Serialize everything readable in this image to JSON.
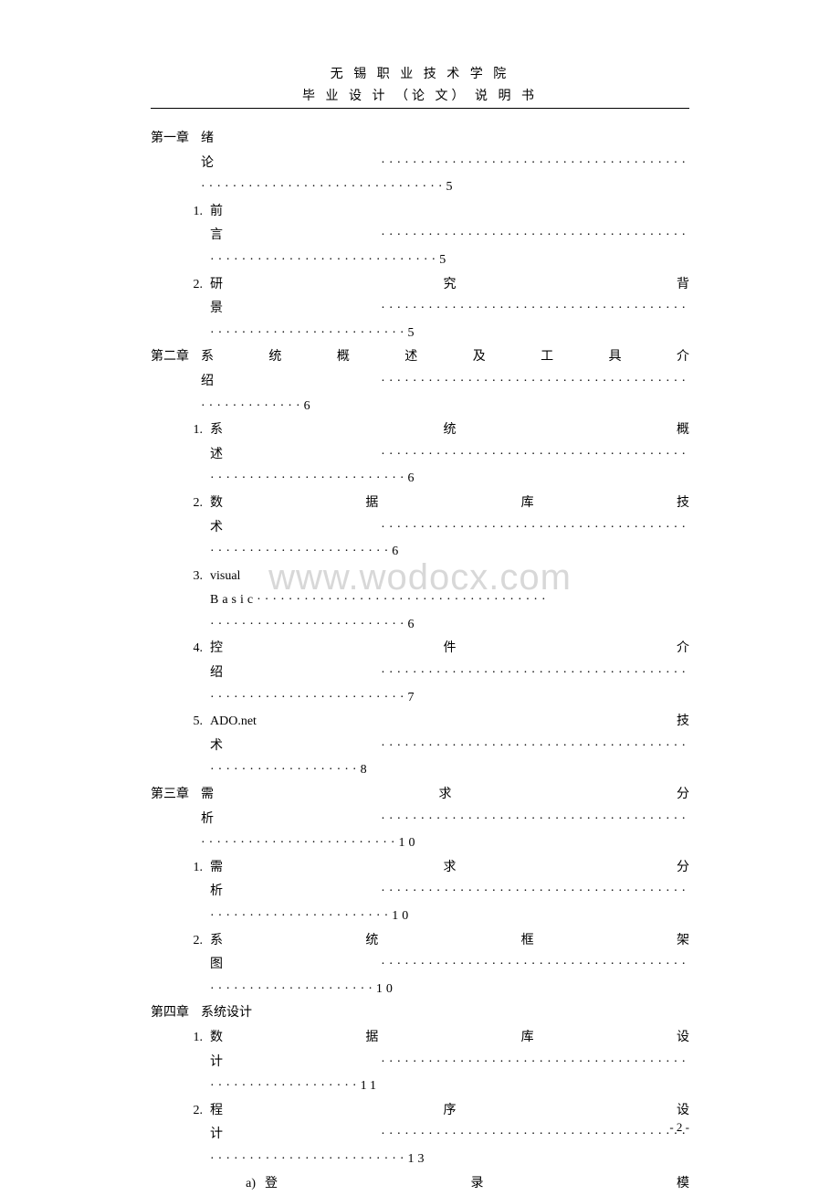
{
  "header": {
    "line1": "无 锡 职 业 技 术 学 院",
    "line2": "毕 业 设 计 （论 文） 说 明 书"
  },
  "watermark": "www.wodocx.com",
  "pageNumber": "- 2 -",
  "toc": [
    {
      "type": "chapter",
      "label": "第一章",
      "title": "绪",
      "content": "论·······································",
      "dots2": "·······························5"
    },
    {
      "type": "section",
      "num": "1.",
      "title": "前",
      "content": "言·······································",
      "dots2": "·····························5"
    },
    {
      "type": "section",
      "num": "2.",
      "titleParts": [
        "研",
        "究",
        "背"
      ],
      "content": "景·······································",
      "dots2": "·························5"
    },
    {
      "type": "chapter",
      "label": "第二章",
      "titleParts": [
        "系",
        "统",
        "概",
        "述",
        "及",
        "工",
        "具",
        "介"
      ],
      "content": "绍·······································",
      "dots2": "·············6"
    },
    {
      "type": "section",
      "num": "1.",
      "titleParts": [
        "系",
        "统",
        "概"
      ],
      "content": "述·······································",
      "dots2": "·························6"
    },
    {
      "type": "section",
      "num": "2.",
      "titleParts": [
        "数",
        "据",
        "库",
        "技"
      ],
      "content": "术·······································",
      "dots2": "·······················6"
    },
    {
      "type": "section",
      "num": "3.",
      "title": "visual",
      "content": "Basic·····································",
      "dots2": "·························6"
    },
    {
      "type": "section",
      "num": "4.",
      "titleParts": [
        "控",
        "件",
        "介"
      ],
      "content": "绍·······································",
      "dots2": "·························7"
    },
    {
      "type": "section",
      "num": "5.",
      "titleParts": [
        "ADO.net",
        "技"
      ],
      "content": "术·······································",
      "dots2": "···················8"
    },
    {
      "type": "chapter",
      "label": "第三章",
      "titleParts": [
        "需",
        "求",
        "分"
      ],
      "content": "析·······································",
      "dots2": "·························10"
    },
    {
      "type": "section",
      "num": "1.",
      "titleParts": [
        "需",
        "求",
        "分"
      ],
      "content": "析·······································",
      "dots2": "·······················10"
    },
    {
      "type": "section",
      "num": "2.",
      "titleParts": [
        "系",
        "统",
        "框",
        "架"
      ],
      "content": "图·······································",
      "dots2": "·····················10"
    },
    {
      "type": "chapter",
      "label": "第四章",
      "title": "系统设计"
    },
    {
      "type": "section",
      "num": "1.",
      "titleParts": [
        "数",
        "据",
        "库",
        "设"
      ],
      "content": "计·······································",
      "dots2": "···················11"
    },
    {
      "type": "section",
      "num": "2.",
      "titleParts": [
        "程",
        "序",
        "设"
      ],
      "content": "计·······································",
      "dots2": "·························13"
    },
    {
      "type": "subsection",
      "num": "a)",
      "titleParts": [
        "登",
        "录",
        "模"
      ]
    }
  ]
}
